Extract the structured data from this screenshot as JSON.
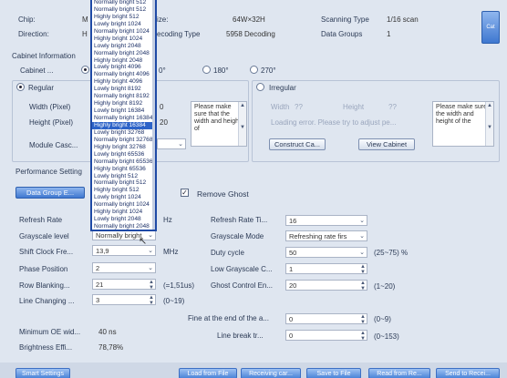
{
  "top": {
    "chip_label": "Chip:",
    "chip_value": "M",
    "direction_label": "Direction:",
    "direction_value": "H",
    "size_label_tail": "ize:",
    "size_value": "64W×32H",
    "decoding_label_tail": "ecoding Type",
    "decoding_value": "5958 Decoding",
    "scanning_label": "Scanning Type",
    "scanning_value": "1/16 scan",
    "data_groups_label": "Data Groups",
    "data_groups_value": "1",
    "corner_button": "Cat"
  },
  "cabinet": {
    "section_title": "Cabinet Information",
    "cabinet_label": "Cabinet ...",
    "rotation_options": [
      "0°",
      "180°",
      "270°"
    ],
    "regular_label": "Regular",
    "irregular_label": "Irregular",
    "width_label": "Width (Pixel)",
    "height_label": "Height (Pixel)",
    "width_value": "0",
    "height_value": "20",
    "module_label": "Module Casc...",
    "note_left": "Please make sure that the width and height of",
    "irr_width_label": "Width",
    "irr_width_value": "??",
    "irr_height_label": "Height",
    "irr_height_value": "??",
    "loading_error": "Loading error. Please try to adjust pe...",
    "note_right": "Please make sure the width and height of the",
    "construct_button": "Construct Ca...",
    "view_button": "View Cabinet"
  },
  "performance": {
    "section_title": "Performance Setting",
    "data_group_button": "Data Group E...",
    "remove_ghost_label": "Remove Ghost",
    "refresh_rate_label": "Refresh Rate",
    "refresh_unit": "Hz",
    "grayscale_label": "Grayscale level",
    "grayscale_value": "Normally bright",
    "shift_clock_label": "Shift Clock Fre...",
    "shift_clock_value": "13,9",
    "shift_unit": "MHz",
    "phase_label": "Phase Position",
    "phase_value": "2",
    "row_blanking_label": "Row Blanking...",
    "row_blanking_value": "21",
    "row_blanking_hint": "(=1,51us)",
    "line_changing_label": "Line Changing ...",
    "line_changing_value": "3",
    "line_changing_hint": "(0~19)",
    "refresh_rate_ti_label": "Refresh Rate Ti...",
    "refresh_rate_ti_value": "16",
    "grayscale_mode_label": "Grayscale Mode",
    "grayscale_mode_value": "Refreshing rate firs",
    "duty_label": "Duty cycle",
    "duty_value": "50",
    "duty_hint": "(25~75) %",
    "low_gray_label": "Low Grayscale C...",
    "low_gray_value": "1",
    "ghost_label": "Ghost Control En...",
    "ghost_value": "20",
    "ghost_hint": "(1~20)",
    "fine_label": "Fine at the end of the a...",
    "fine_value": "0",
    "fine_hint": "(0~9)",
    "line_break_label": "Line break tr...",
    "line_break_value": "0",
    "line_break_hint": "(0~153)",
    "min_oe_label": "Minimum OE wid...",
    "min_oe_value": "40 ns",
    "brightness_label": "Brightness Effi...",
    "brightness_value": "78,78%"
  },
  "popup": {
    "items": [
      "Normally bright 512",
      "Normally bright 512",
      "Highly bright 512",
      "Lowly bright 1024",
      "Normally bright 1024",
      "Highly bright 1024",
      "Lowly bright 2048",
      "Normally bright 2048",
      "Highly bright 2048",
      "Lowly bright 4096",
      "Normally bright 4096",
      "Highly bright 4096",
      "Lowly bright 8192",
      "Normally bright 8192",
      "Highly bright 8192",
      "Lowly bright 16384",
      "Normally bright 16384",
      "Highly bright 16384",
      "Lowly bright 32768",
      "Normally bright 32768",
      "Highly bright 32768",
      "Lowly bright 65536",
      "Normally bright 65536",
      "Highly bright 65536",
      "Lowly bright 512",
      "Normally bright 512",
      "Highly bright 512",
      "Lowly bright 1024",
      "Normally bright 1024",
      "Highly bright 1024",
      "Lowly bright 2048",
      "Normally bright 2048"
    ],
    "highlight_index": 17
  },
  "bottom": {
    "smart_settings": "Smart Settings",
    "load_from_file": "Load from File",
    "receiving_card": "Receiving car...",
    "save_to_file": "Save to File",
    "read_from_re": "Read from Re...",
    "send_to_receiver": "Send to Recei..."
  },
  "colors": {
    "background": "#dfe6f0",
    "accent": "#2d63c8",
    "popup_border": "#1f4aa6"
  }
}
